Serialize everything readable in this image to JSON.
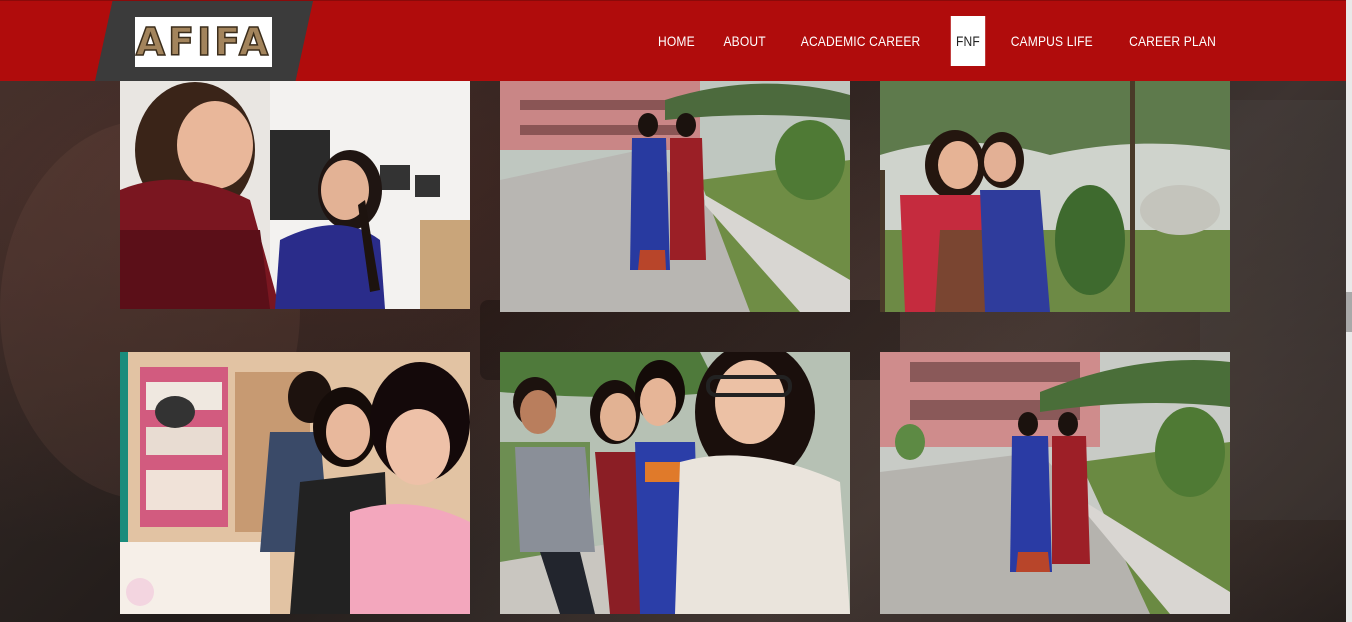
{
  "site": {
    "logo_text": "AFIFA"
  },
  "nav": {
    "items": [
      {
        "label": "HOME"
      },
      {
        "label": "ABOUT"
      },
      {
        "label": "ACADEMIC CAREER"
      },
      {
        "label": "FNF",
        "active": true
      },
      {
        "label": "CAMPUS LIFE"
      },
      {
        "label": "CAREER PLAN"
      }
    ]
  },
  "colors": {
    "header": "#b00c0c",
    "logo_band": "#3b3b3b",
    "logo_text": "#a3845c",
    "active_nav_bg": "#ffffff"
  },
  "gallery": {
    "photos": [
      {
        "subject": "two-women-selfie-lab"
      },
      {
        "subject": "two-women-campus-path"
      },
      {
        "subject": "two-women-under-trees"
      },
      {
        "subject": "four-women-room-selfie"
      },
      {
        "subject": "group-selfie-campus"
      },
      {
        "subject": "two-women-campus-path-wide"
      }
    ]
  }
}
